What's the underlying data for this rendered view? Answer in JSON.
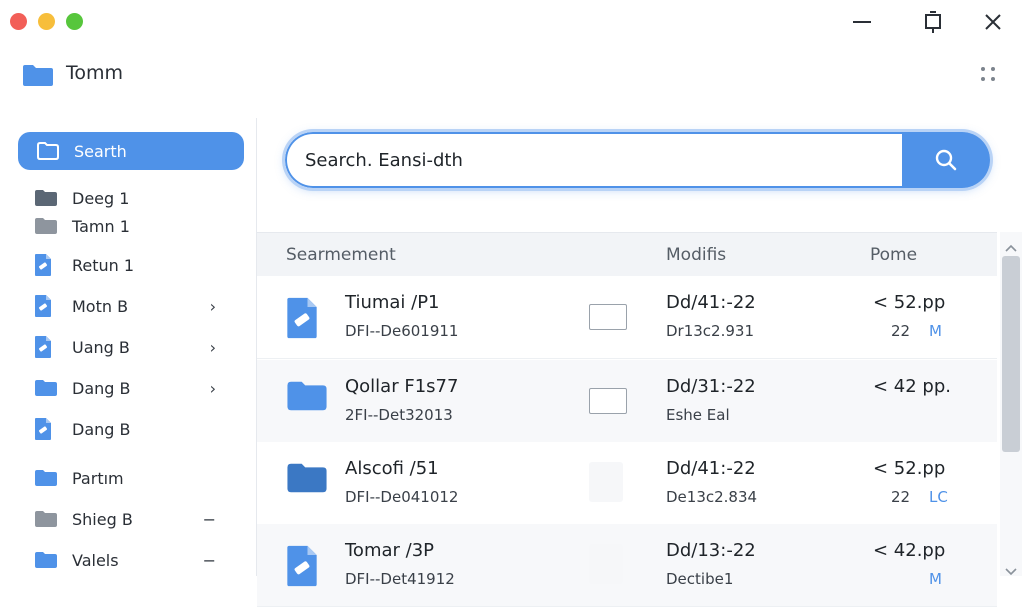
{
  "window": {
    "controls": [
      "close",
      "minimize",
      "zoom"
    ],
    "colors": {
      "close": "#f25f58",
      "minimize": "#f7be3b",
      "zoom": "#57c63c",
      "accent": "#4f92e8"
    }
  },
  "app": {
    "title": "Tomm"
  },
  "sidebar": {
    "items": [
      {
        "label": "Searth",
        "icon": "folder-outline-icon",
        "active": true,
        "trail": ""
      },
      {
        "label": "Deeg 1",
        "icon": "folder-icon",
        "trail": ""
      },
      {
        "label": "Tamn 1",
        "icon": "folder-icon",
        "trail": ""
      },
      {
        "label": "Retun 1",
        "icon": "document-icon",
        "trail": ""
      },
      {
        "label": "Motn B",
        "icon": "document-icon",
        "trail": "›"
      },
      {
        "label": "Uang B",
        "icon": "document-icon",
        "trail": "›"
      },
      {
        "label": "Dang B",
        "icon": "folder-icon",
        "trail": "›"
      },
      {
        "label": "Dang B",
        "icon": "document-icon",
        "trail": ""
      },
      {
        "label": "Partım",
        "icon": "folder-icon",
        "trail": ""
      },
      {
        "label": "Shieg B",
        "icon": "folder-icon",
        "trail": "−"
      },
      {
        "label": "Valels",
        "icon": "folder-icon",
        "trail": "−"
      }
    ]
  },
  "search": {
    "value": "Search. Eansi-dth"
  },
  "list": {
    "headers": {
      "name": "Searmement",
      "modified": "Modifis",
      "size": "Pome"
    },
    "rows": [
      {
        "icon": "document-icon",
        "name": "Tiumai  /P1",
        "sub": "DFI--De601911",
        "check": "box",
        "mod1": "Dd/41:-22",
        "mod2": "Dr13c2.931",
        "size1": "< 52.pp",
        "size2": "22",
        "size3": "M"
      },
      {
        "icon": "folder-icon",
        "name": "Qollar F1s77",
        "sub": "2FI--Det32013",
        "check": "box",
        "mod1": "Dd/31:-22",
        "mod2": "Eshe Eal",
        "size1": "< 42 pp.",
        "size2": "",
        "size3": ""
      },
      {
        "icon": "folder-icon",
        "name": "Alscofi  /51",
        "sub": "DFI--De041012",
        "check": "ghost",
        "mod1": "Dd/41:-22",
        "mod2": "De13c2.834",
        "size1": "< 52.pp",
        "size2": "22",
        "size3": "LC"
      },
      {
        "icon": "document-icon",
        "name": "Tomar  /3P",
        "sub": "DFI--Det41912",
        "check": "ghost",
        "mod1": "Dd/13:-22",
        "mod2": "Dectibe1",
        "size1": "< 42.pp",
        "size2": "",
        "size3": "M"
      }
    ]
  }
}
